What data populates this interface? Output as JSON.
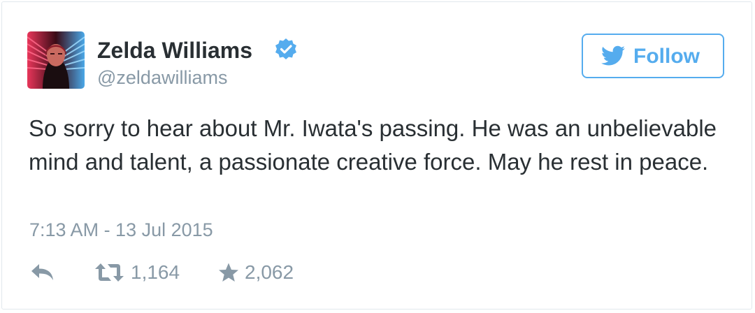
{
  "tweet": {
    "author": {
      "name": "Zelda Williams",
      "handle": "@zeldawilliams",
      "verified": true,
      "avatar": "avatar-photo"
    },
    "follow_button": {
      "label": "Follow",
      "icon": "twitter-bird-icon"
    },
    "text": "So sorry to hear about Mr. Iwata's passing. He was an unbelievable mind and talent, a passionate creative force. May he rest in peace.",
    "timestamp": "7:13 AM - 13 Jul 2015",
    "actions": {
      "reply": {
        "icon": "reply-icon"
      },
      "retweet": {
        "icon": "retweet-icon",
        "count": "1,164"
      },
      "favorite": {
        "icon": "star-icon",
        "count": "2,062"
      }
    }
  },
  "colors": {
    "accent": "#55acee",
    "text": "#292f33",
    "muted": "#8899a6",
    "border": "#e1e8ed"
  }
}
